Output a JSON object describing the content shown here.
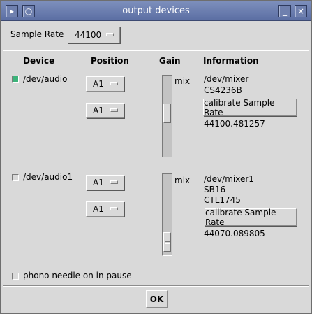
{
  "window": {
    "title": "output devices"
  },
  "sample_rate": {
    "label": "Sample Rate",
    "value": "44100"
  },
  "headers": {
    "device": "Device",
    "position": "Position",
    "gain": "Gain",
    "information": "Information"
  },
  "devices": [
    {
      "name": "/dev/audio",
      "enabled": true,
      "positions": [
        "A1",
        "A1"
      ],
      "gain_label": "mix",
      "info": [
        "/dev/mixer",
        "CS4236B"
      ],
      "calibrate_label": "calibrate Sample Rate",
      "measured_rate": "44100.481257"
    },
    {
      "name": "/dev/audio1",
      "enabled": false,
      "positions": [
        "A1",
        "A1"
      ],
      "gain_label": "mix",
      "info": [
        "/dev/mixer1",
        "SB16",
        "CTL1745"
      ],
      "calibrate_label": "calibrate Sample Rate",
      "measured_rate": "44070.089805"
    }
  ],
  "phono_needle": {
    "label": "phono needle on in pause",
    "checked": false
  },
  "ok_button": {
    "label": "OK"
  },
  "colors": {
    "titlebar": "#6a7db0",
    "background": "#d9d9d9",
    "check_on": "#3cb37a"
  }
}
